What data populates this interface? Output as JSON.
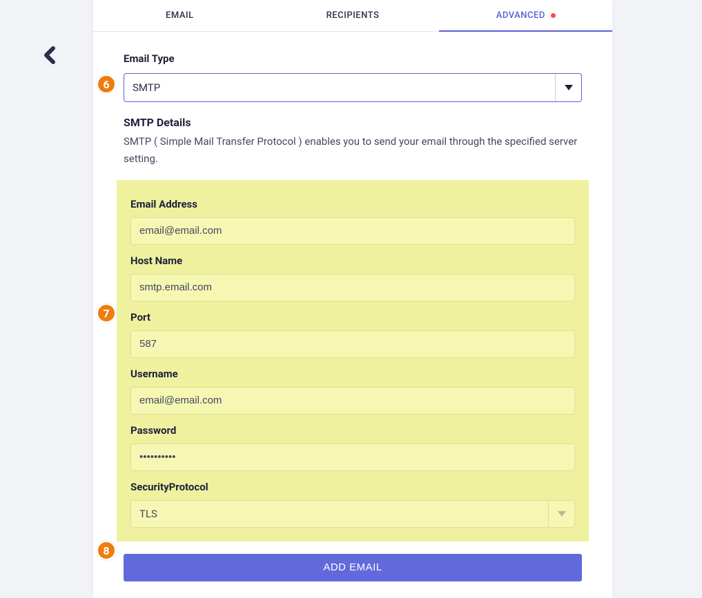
{
  "tabs": {
    "email": "EMAIL",
    "recipients": "RECIPIENTS",
    "advanced": "ADVANCED"
  },
  "email_type": {
    "label": "Email Type",
    "value": "SMTP"
  },
  "smtp_details": {
    "heading": "SMTP Details",
    "description": "SMTP ( Simple Mail Transfer Protocol ) enables you to send your email through the specified server setting."
  },
  "fields": {
    "email_address": {
      "label": "Email Address",
      "value": "email@email.com"
    },
    "host_name": {
      "label": "Host Name",
      "value": "smtp.email.com"
    },
    "port": {
      "label": "Port",
      "value": "587"
    },
    "username": {
      "label": "Username",
      "value": "email@email.com"
    },
    "password": {
      "label": "Password",
      "value": "••••••••••"
    },
    "security_protocol": {
      "label": "SecurityProtocol",
      "value": "TLS"
    }
  },
  "submit_label": "ADD EMAIL",
  "annotations": {
    "six": "6",
    "seven": "7",
    "eight": "8"
  }
}
